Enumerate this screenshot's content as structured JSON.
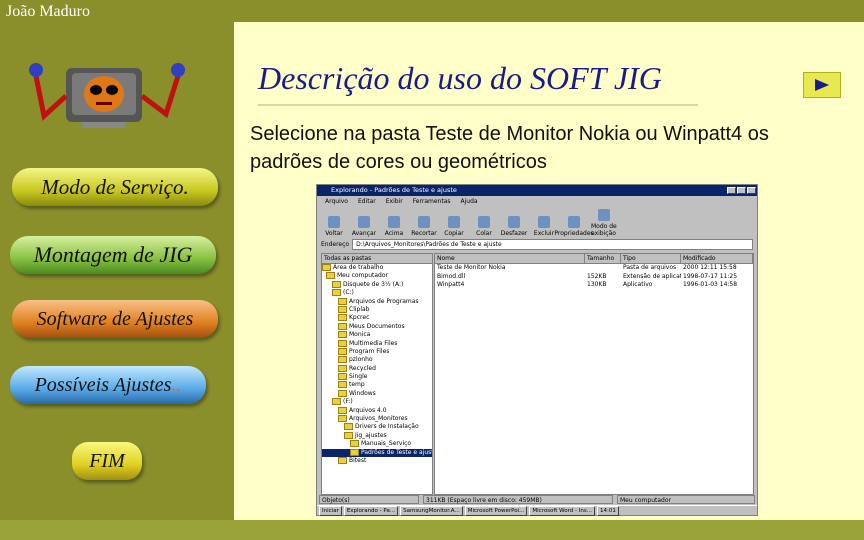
{
  "author": "João Maduro",
  "title": "Descrição do uso do SOFT JIG",
  "description": "Selecione na pasta Teste de Monitor Nokia ou Winpatt4 os padrões de cores ou geométricos",
  "nav": {
    "modo_servico": "Modo de Serviço.",
    "montagem": "Montagem de JIG",
    "software": "Software de Ajustes",
    "possiveis": "Possíveis Ajustes",
    "possiveis_suffix": "..",
    "fim": "FIM"
  },
  "next_icon": "play-triangle-icon",
  "colors": {
    "sidebar": "#8a8f2c",
    "content": "#ffffc8",
    "title": "#1a1a8c"
  },
  "explorer": {
    "window_title": "Explorando - Padrões de Teste e ajuste",
    "menu": [
      "Arquivo",
      "Editar",
      "Exibir",
      "Ferramentas",
      "Ajuda"
    ],
    "toolbar": [
      "Voltar",
      "Avançar",
      "Acima",
      "Recortar",
      "Copiar",
      "Colar",
      "Desfazer",
      "Excluir",
      "Propriedades",
      "Modo de exibição"
    ],
    "address_label": "Endereço",
    "address_value": "D:\\Arquivos_Monitores\\Padrões de Teste e ajuste",
    "tree_header": "Todas as pastas",
    "tree": [
      "Área de trabalho",
      "Meu computador",
      "Disquete de 3½ (A:)",
      "(C:)",
      "Arquivos de Programas",
      "Cliplab",
      "Kpcrec",
      "Meus Documentos",
      "Monica",
      "Multimedia Files",
      "Program Files",
      "pzlonho",
      "Recycled",
      "Single",
      "temp",
      "Windows",
      "(F:)",
      "Arquivos 4.0",
      "Arquivos_Monitores",
      "Drivers de Instalação",
      "Jig_ajustes",
      "Manuais_Serviço",
      "Padrões de Teste e ajuste",
      "Bitest"
    ],
    "columns": [
      "Nome",
      "Tamanho",
      "Tipo",
      "Modificado"
    ],
    "files": [
      {
        "name": "Teste de Monitor Nokia",
        "size": "",
        "type": "Pasta de arquivos",
        "modified": "2000 12:11 15:58"
      },
      {
        "name": "Bimod.dll",
        "size": "152KB",
        "type": "Extensão de aplicativo",
        "modified": "1998-07-17 11:25"
      },
      {
        "name": "Winpatt4",
        "size": "130KB",
        "type": "Aplicativo",
        "modified": "1996-01-03 14:58"
      }
    ],
    "status": [
      "Objeto(s)",
      "311KB (Espaço livre em disco: 459MB)",
      "Meu computador"
    ],
    "taskbar": [
      "Iniciar",
      "Explorando - Pa...",
      "SamsungMonitor.A...",
      "Microsoft PowerPoi...",
      "Microsoft Word - Ins...",
      "14:01"
    ]
  }
}
